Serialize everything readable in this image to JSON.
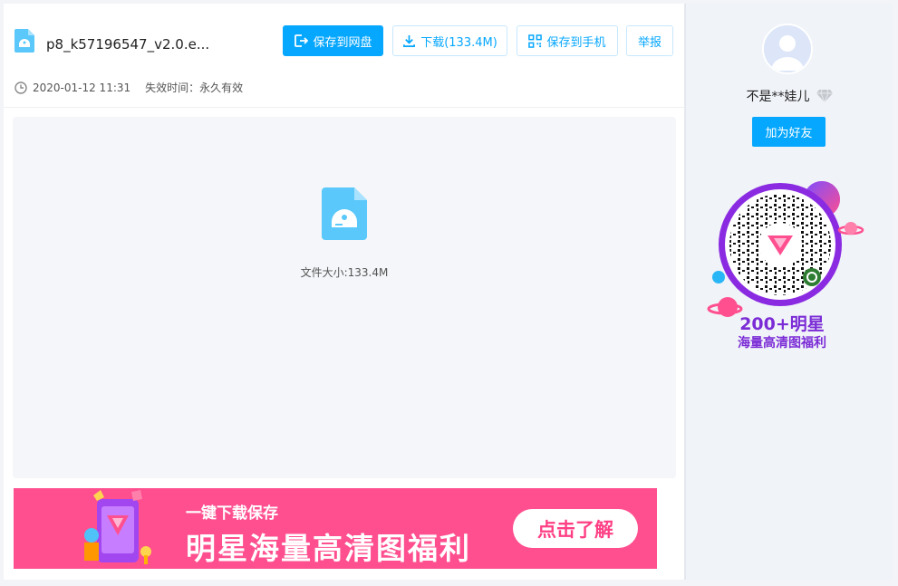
{
  "file": {
    "name": "p8_k57196547_v2.0.e...",
    "date": "2020-01-12 11:31",
    "expiry_label": "失效时间：永久有效",
    "size_text": "文件大小:133.4M"
  },
  "toolbar": {
    "save_cloud": "保存到网盘",
    "download": "下载(133.4M)",
    "save_phone": "保存到手机",
    "report": "举报"
  },
  "banner": {
    "subtitle": "一键下载保存",
    "title": "明星海量高清图福利",
    "button": "点击了解"
  },
  "sidebar": {
    "username": "不是**娃儿",
    "add_friend": "加为好友",
    "promo_line1": "200+明星",
    "promo_line2": "海量高清图福利"
  },
  "colors": {
    "accent": "#06a7ff",
    "banner": "#ff4f8f",
    "promo": "#7b2cd6"
  }
}
